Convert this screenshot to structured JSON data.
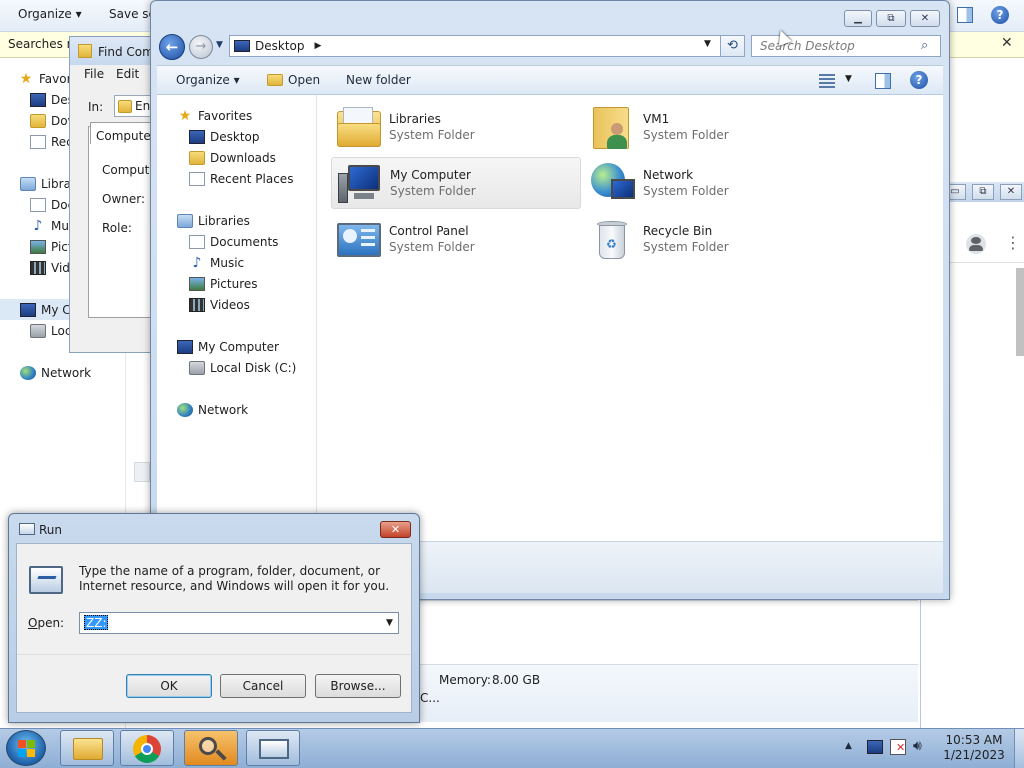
{
  "background_explorer": {
    "toolbar": {
      "organize": "Organize",
      "save_search": "Save sea"
    },
    "searchbar": {
      "text": "Searches m"
    },
    "nav": {
      "favorites": "Favor",
      "desktop": "Des",
      "downloads": "Dov",
      "recent": "Rec",
      "libraries": "Librar",
      "documents": "Doc",
      "music": "Mu",
      "pictures": "Pict",
      "videos": "Vid",
      "my_computer": "My C",
      "local_disk": "Loc",
      "network": "Network"
    },
    "status": {
      "memory_label": "Memory:",
      "memory_value": "8.00 GB",
      "extra": "C..."
    }
  },
  "find_dialog": {
    "title": "Find Com",
    "menu": {
      "file": "File",
      "edit": "Edit"
    },
    "in_label": "In:",
    "in_value": "En",
    "tab": "Computers",
    "fields": {
      "computer": "Computer",
      "owner": "Owner:",
      "role": "Role:"
    }
  },
  "explorer": {
    "address": {
      "location": "Desktop"
    },
    "search": {
      "placeholder": "Search Desktop"
    },
    "commands": {
      "organize": "Organize",
      "open": "Open",
      "new_folder": "New folder"
    },
    "nav": {
      "favorites": "Favorites",
      "desktop": "Desktop",
      "downloads": "Downloads",
      "recent_places": "Recent Places",
      "libraries": "Libraries",
      "documents": "Documents",
      "music": "Music",
      "pictures": "Pictures",
      "videos": "Videos",
      "my_computer": "My Computer",
      "local_disk": "Local Disk (C:)",
      "network": "Network"
    },
    "items": [
      {
        "name": "Libraries",
        "type": "System Folder"
      },
      {
        "name": "VM1",
        "type": "System Folder"
      },
      {
        "name": "My Computer",
        "type": "System Folder"
      },
      {
        "name": "Network",
        "type": "System Folder"
      },
      {
        "name": "Control Panel",
        "type": "System Folder"
      },
      {
        "name": "Recycle Bin",
        "type": "System Folder"
      }
    ]
  },
  "run_dialog": {
    "title": "Run",
    "description": "Type the name of a program, folder, document, or Internet resource, and Windows will open it for you.",
    "open_label": "Open:",
    "open_value": "ZZ:",
    "buttons": {
      "ok": "OK",
      "cancel": "Cancel",
      "browse": "Browse..."
    }
  },
  "taskbar": {
    "time": "10:53 AM",
    "date": "1/21/2023"
  }
}
